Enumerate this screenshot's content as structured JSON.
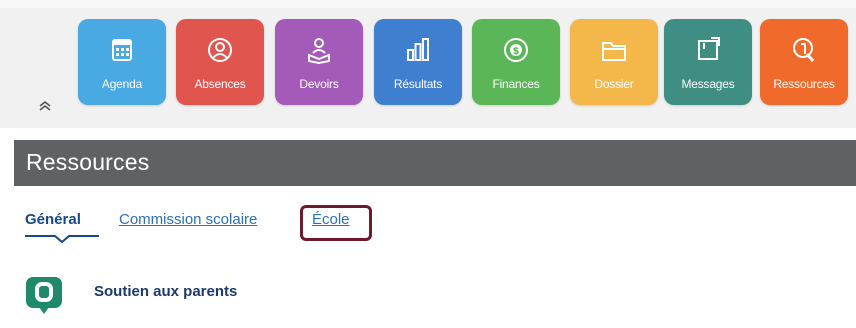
{
  "nav": {
    "collapse_icon": "double-chevron-up-icon",
    "tiles": [
      {
        "label": "Agenda",
        "icon": "calendar-icon",
        "color": "#49a9e3"
      },
      {
        "label": "Absences",
        "icon": "person-icon",
        "color": "#e0554d"
      },
      {
        "label": "Devoirs",
        "icon": "reading-icon",
        "color": "#a45ab8"
      },
      {
        "label": "Résultats",
        "icon": "bar-chart-icon",
        "color": "#3f7fcf"
      },
      {
        "label": "Finances",
        "icon": "coin-icon",
        "color": "#5bb658"
      },
      {
        "label": "Dossier",
        "icon": "folder-icon",
        "color": "#f4b84a"
      },
      {
        "label": "Messages",
        "icon": "note-icon",
        "color": "#3e8e83"
      },
      {
        "label": "Ressources",
        "icon": "resource-icon",
        "color": "#f06a2b"
      }
    ]
  },
  "section": {
    "title": "Ressources"
  },
  "tabs": {
    "items": [
      {
        "label": "Général"
      },
      {
        "label": "Commission scolaire"
      },
      {
        "label": "École"
      }
    ]
  },
  "resources": {
    "items": [
      {
        "label": "Soutien aux parents",
        "icon": "chat-bubble-icon",
        "color": "#1f8a6a"
      }
    ]
  }
}
